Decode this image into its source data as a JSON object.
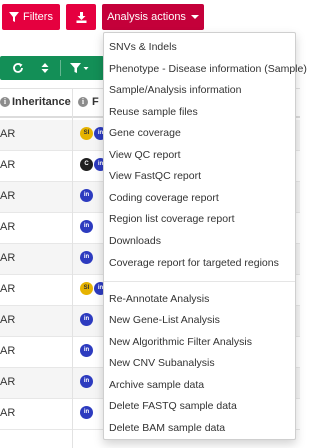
{
  "toolbar": {
    "filters_label": "Filters",
    "analysis_actions_label": "Analysis actions"
  },
  "colors": {
    "primary": "#e5003f",
    "primary_active": "#c4003a",
    "secondary_toolbar": "#138f57",
    "badge_blue": "#2d3bbf",
    "badge_gold": "#e6b300"
  },
  "table": {
    "headers": [
      {
        "label": "Inheritance",
        "icon": "info-icon"
      },
      {
        "label": "F",
        "icon": "info-icon"
      }
    ],
    "rows": [
      {
        "inheritance": "AR",
        "badges": [
          {
            "text": "SI",
            "color": "gold"
          },
          {
            "text": "in",
            "color": "blue"
          }
        ]
      },
      {
        "inheritance": "AR",
        "badges": [
          {
            "text": "C",
            "color": "black"
          },
          {
            "text": "in",
            "color": "blue"
          }
        ]
      },
      {
        "inheritance": "AR",
        "badges": [
          {
            "text": "in",
            "color": "blue"
          }
        ]
      },
      {
        "inheritance": "AR",
        "badges": [
          {
            "text": "in",
            "color": "blue"
          }
        ]
      },
      {
        "inheritance": "AR",
        "badges": [
          {
            "text": "in",
            "color": "blue"
          }
        ]
      },
      {
        "inheritance": "AR",
        "badges": [
          {
            "text": "SI",
            "color": "gold"
          },
          {
            "text": "in",
            "color": "blue"
          }
        ]
      },
      {
        "inheritance": "AR",
        "badges": [
          {
            "text": "in",
            "color": "blue"
          }
        ]
      },
      {
        "inheritance": "AR",
        "badges": [
          {
            "text": "in",
            "color": "blue"
          }
        ]
      },
      {
        "inheritance": "AR",
        "badges": [
          {
            "text": "in",
            "color": "blue"
          }
        ]
      },
      {
        "inheritance": "AR",
        "badges": [
          {
            "text": "in",
            "color": "blue"
          }
        ]
      }
    ]
  },
  "analysis_menu": {
    "section1": [
      "SNVs & Indels",
      "Phenotype - Disease information (Sample)",
      "Sample/Analysis information",
      "Reuse sample files",
      "Gene coverage",
      "View QC report",
      "View FastQC report",
      "Coding coverage report",
      "Region list coverage report",
      "Downloads",
      "Coverage report for targeted regions"
    ],
    "section2": [
      "Re-Annotate Analysis",
      "New Gene-List Analysis",
      "New Algorithmic Filter Analysis",
      "New CNV Subanalysis",
      "Archive sample data",
      "Delete FASTQ sample data",
      "Delete BAM sample data"
    ]
  }
}
